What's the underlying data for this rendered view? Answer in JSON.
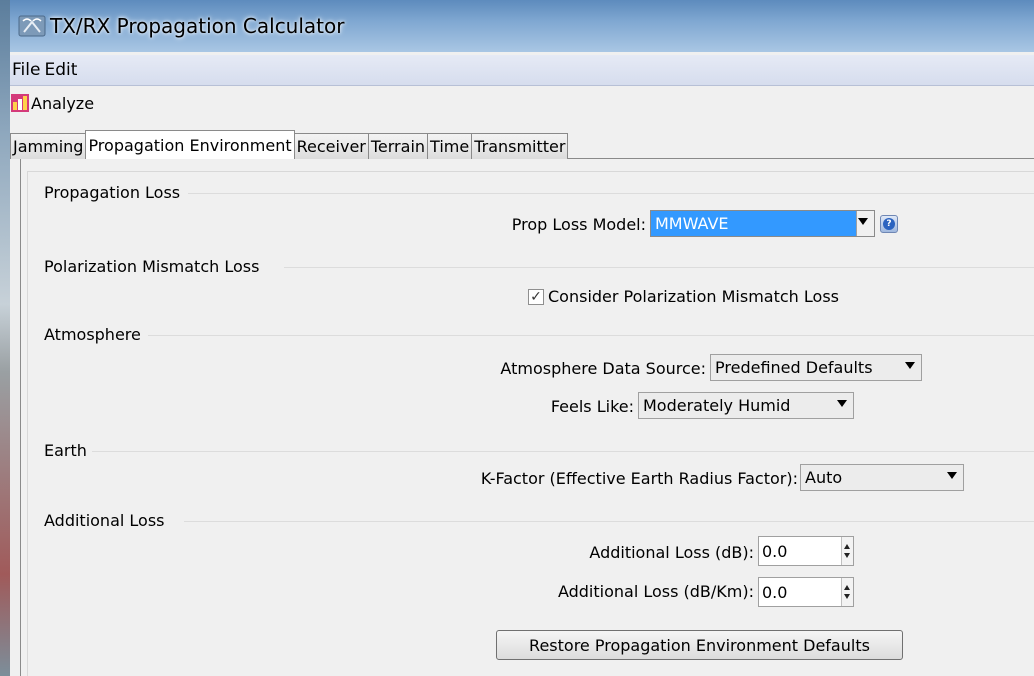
{
  "window": {
    "title": "TX/RX Propagation Calculator"
  },
  "menu": {
    "file": "File",
    "edit": "Edit"
  },
  "toolbar": {
    "analyze": "Analyze"
  },
  "tabs": [
    {
      "label": "Jamming",
      "active": false
    },
    {
      "label": "Propagation Environment",
      "active": true
    },
    {
      "label": "Receiver",
      "active": false
    },
    {
      "label": "Terrain",
      "active": false
    },
    {
      "label": "Time",
      "active": false
    },
    {
      "label": "Transmitter",
      "active": false
    }
  ],
  "sections": {
    "propagation_loss": {
      "title": "Propagation Loss",
      "model_label": "Prop Loss Model:",
      "model_value": "MMWAVE"
    },
    "polarization": {
      "title": "Polarization Mismatch Loss",
      "checkbox_label": "Consider Polarization Mismatch Loss",
      "checked": true
    },
    "atmosphere": {
      "title": "Atmosphere",
      "source_label": "Atmosphere Data Source:",
      "source_value": "Predefined Defaults",
      "feels_label": "Feels Like:",
      "feels_value": "Moderately Humid"
    },
    "earth": {
      "title": "Earth",
      "kfactor_label": "K-Factor (Effective Earth Radius Factor):",
      "kfactor_value": "Auto"
    },
    "additional_loss": {
      "title": "Additional Loss",
      "db_label": "Additional Loss (dB):",
      "db_value": "0.0",
      "dbkm_label": "Additional Loss (dB/Km):",
      "dbkm_value": "0.0"
    }
  },
  "restore_button": "Restore Propagation Environment Defaults",
  "colors": {
    "selection": "#3399ff",
    "title_gradient_top": "#5d8bbd"
  }
}
